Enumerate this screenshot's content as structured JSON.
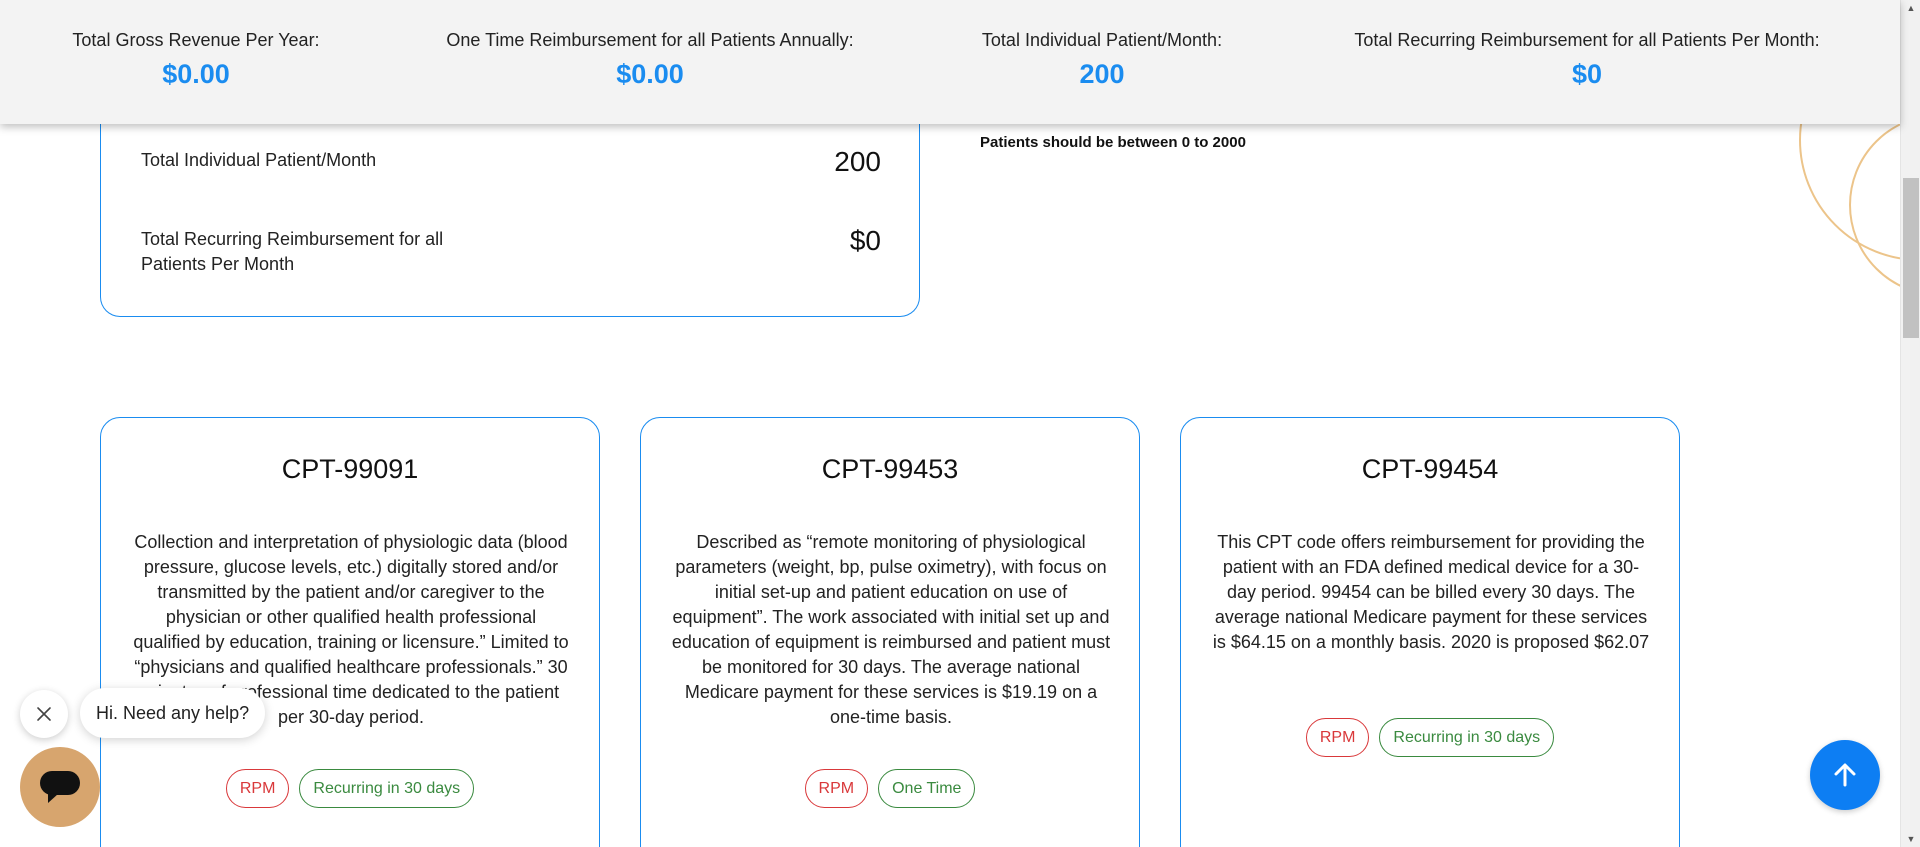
{
  "summary": {
    "gross_revenue": {
      "label": "Total Gross Revenue Per Year:",
      "value": "$0.00"
    },
    "one_time": {
      "label": "One Time Reimbursement for all Patients Annually:",
      "value": "$0.00"
    },
    "individual": {
      "label": "Total Individual Patient/Month:",
      "value": "200"
    },
    "recurring": {
      "label": "Total Recurring Reimbursement for all Patients Per Month:",
      "value": "$0"
    }
  },
  "top_card": {
    "rows": [
      {
        "label": "Total Individual Patient/Month",
        "value": "200"
      },
      {
        "label": "Total Recurring Reimbursement for all Patients Per Month",
        "value": "$0"
      }
    ]
  },
  "note": "Patients should be between 0 to 2000",
  "cpt_cards": [
    {
      "title": "CPT-99091",
      "description": "Collection and interpretation of physiologic data (blood pressure, glucose levels, etc.) digitally stored and/or transmitted by the patient and/or caregiver to the physician or other qualified health professional qualified by education, training or licensure.” Limited to “physicians and qualified healthcare professionals.” 30 minutes of professional time dedicated to the patient per 30-day period.",
      "tags": [
        "RPM",
        "Recurring in 30 days"
      ]
    },
    {
      "title": "CPT-99453",
      "description": "Described as “remote monitoring of physiological parameters (weight, bp, pulse oximetry), with focus on initial set-up and patient education on use of equipment”. The work associated with initial set up and education of equipment is reimbursed and patient must be monitored for 30 days. The average national Medicare payment for these services is $19.19 on a one-time basis.",
      "tags": [
        "RPM",
        "One Time"
      ]
    },
    {
      "title": "CPT-99454",
      "description": "This CPT code offers reimbursement for providing the patient with an FDA defined medical device for a 30-day period. 99454 can be billed every 30 days. The average national Medicare payment for these services is $64.15 on a monthly basis. 2020 is proposed $62.07",
      "tags": [
        "RPM",
        "Recurring in 30 days"
      ]
    }
  ],
  "chat": {
    "greeting": "Hi. Need any help?"
  },
  "colors": {
    "accent": "#1a8cf0",
    "tag_red": "#d9383a",
    "tag_green": "#3a8a3f",
    "chat": "#d7a56e"
  },
  "icons": {
    "close": "close-icon",
    "chat": "chat-icon",
    "scroll_top": "arrow-up-icon"
  }
}
